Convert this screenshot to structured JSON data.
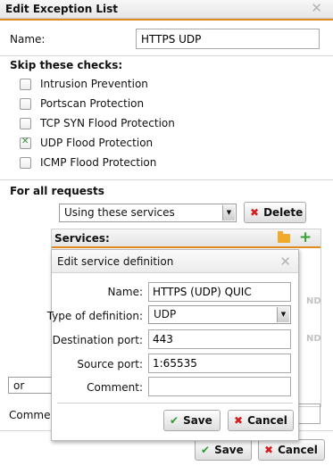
{
  "window": {
    "title": "Edit Exception List"
  },
  "name": {
    "label": "Name:",
    "value": "HTTPS UDP"
  },
  "skip_checks": {
    "title": "Skip these checks:",
    "items": [
      {
        "label": "Intrusion Prevention",
        "checked": false
      },
      {
        "label": "Portscan Protection",
        "checked": false
      },
      {
        "label": "TCP SYN Flood Protection",
        "checked": false
      },
      {
        "label": "UDP Flood Protection",
        "checked": true
      },
      {
        "label": "ICMP Flood Protection",
        "checked": false
      }
    ]
  },
  "for_all_requests": {
    "title": "For all requests",
    "mode_selected": "Using these services",
    "delete_label": "Delete"
  },
  "services": {
    "header": "Services:",
    "ghost_a": "ND",
    "ghost_b": "ND"
  },
  "condition": {
    "selected": "or"
  },
  "comment": {
    "label": "Comment:"
  },
  "footer": {
    "save_label": "Save",
    "cancel_label": "Cancel"
  },
  "dialog": {
    "title": "Edit service definition",
    "name_label": "Name:",
    "name_value": "HTTPS (UDP) QUIC",
    "type_label": "Type of definition:",
    "type_value": "UDP",
    "dest_label": "Destination port:",
    "dest_value": "443",
    "src_label": "Source port:",
    "src_value": "1:65535",
    "comment_label": "Comment:",
    "comment_value": "",
    "save_label": "Save",
    "cancel_label": "Cancel"
  },
  "colors": {
    "accent": "#e08a1e",
    "ok_green": "#2f9b2f",
    "cancel_red": "#d21e1e",
    "add_green": "#35a035"
  }
}
